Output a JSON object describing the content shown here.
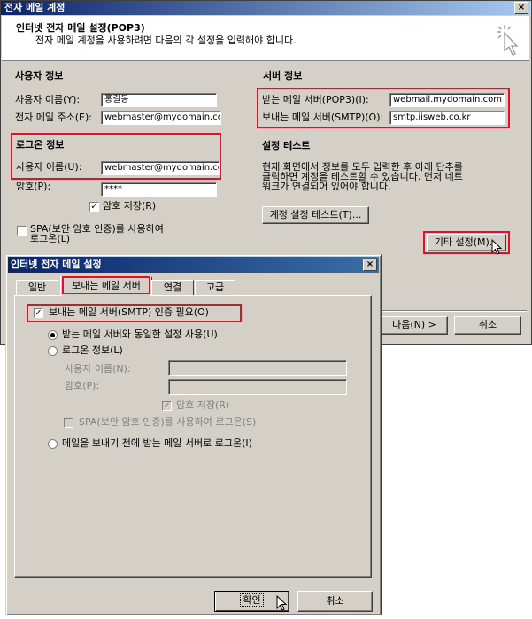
{
  "wizard": {
    "title": "전자 메일 계정",
    "header_title": "인터넷 전자 메일 설정(POP3)",
    "header_subtitle": "전자 메일 계정을 사용하려면 다음의 각 설정을 입력해야 합니다.",
    "user_info": {
      "heading": "사용자 정보",
      "name_label": "사용자 이름(Y):",
      "name_value": "홍길동",
      "email_label": "전자 메일 주소(E):",
      "email_value": "webmaster@mydomain.com"
    },
    "server_info": {
      "heading": "서버 정보",
      "incoming_label": "받는 메일 서버(POP3)(I):",
      "incoming_value": "webmail.mydomain.com",
      "outgoing_label": "보내는 메일 서버(SMTP)(O):",
      "outgoing_value": "smtp.iisweb.co.kr"
    },
    "logon_info": {
      "heading": "로그온 정보",
      "user_label": "사용자 이름(U):",
      "user_value": "webmaster@mydomain.com",
      "password_label": "암호(P):",
      "password_value": "****",
      "save_password_label": "암호 저장(R)",
      "spa_label_line1": "SPA(보안 암호 인증)를 사용하여",
      "spa_label_line2": "로그온(L)"
    },
    "test": {
      "heading": "설정 테스트",
      "desc_line1": "현재 화면에서 정보를 모두 입력한 후 아래 단추를",
      "desc_line2": "클릭하면 계정을 테스트할 수 있습니다. 먼저 네트",
      "desc_line3": "워크가 연결되어 있어야 합니다.",
      "test_button": "계정 설정 테스트(T)..."
    },
    "more_settings_button": "기타 설정(M)...",
    "next_button": "다음(N) >",
    "cancel_button": "취소"
  },
  "dialog": {
    "title": "인터넷 전자 메일 설정",
    "close_glyph": "×",
    "tabs": [
      "일반",
      "보내는 메일 서버",
      "연결",
      "고급"
    ],
    "smtp_auth_label": "보내는 메일 서버(SMTP) 인증 필요(O)",
    "use_same_label": "받는 메일 서버와 동일한 설정 사용(U)",
    "logon_with_label": "로그온 정보(L)",
    "username_label": "사용자 이름(N):",
    "password_label": "암호(P):",
    "save_password_label": "암호 저장(R)",
    "spa_label": "SPA(보안 암호 인증)를 사용하여 로그온(S)",
    "logon_before_label": "메일을 보내기 전에 받는 메일 서버로 로그온(I)",
    "ok_button": "확인",
    "cancel_button": "취소"
  },
  "colors": {
    "highlight_red": "#e0102a",
    "title_blue": "#0a246a",
    "face_gray": "#d4d0c8"
  }
}
